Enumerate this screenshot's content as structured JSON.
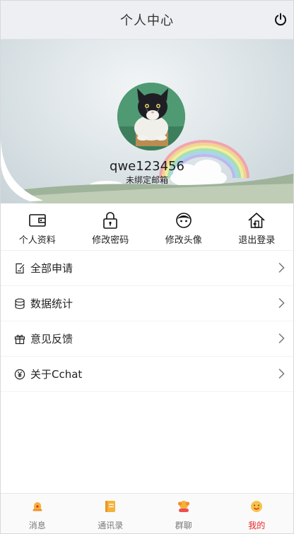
{
  "header": {
    "title": "个人中心",
    "power_icon": "power-icon"
  },
  "profile": {
    "username": "qwe123456",
    "email_status": "未绑定邮箱"
  },
  "actions": [
    {
      "label": "个人资料",
      "icon": "wallet-icon"
    },
    {
      "label": "修改密码",
      "icon": "lock-icon"
    },
    {
      "label": "修改头像",
      "icon": "face-icon"
    },
    {
      "label": "退出登录",
      "icon": "home-exit-icon"
    }
  ],
  "menu": [
    {
      "label": "全部申请",
      "icon": "edit-doc-icon"
    },
    {
      "label": "数据统计",
      "icon": "database-icon"
    },
    {
      "label": "意见反馈",
      "icon": "gift-icon"
    },
    {
      "label": "关于Cchat",
      "icon": "yen-circle-icon"
    }
  ],
  "tabbar": [
    {
      "label": "消息",
      "icon": "bell-icon",
      "active": false
    },
    {
      "label": "通讯录",
      "icon": "contacts-icon",
      "active": false
    },
    {
      "label": "群聊",
      "icon": "group-icon",
      "active": false
    },
    {
      "label": "我的",
      "icon": "me-icon",
      "active": true
    }
  ],
  "colors": {
    "accent": "#e8262a",
    "header_bg": "#eeeff3",
    "tab_icon_orange": "#f5b13a"
  }
}
